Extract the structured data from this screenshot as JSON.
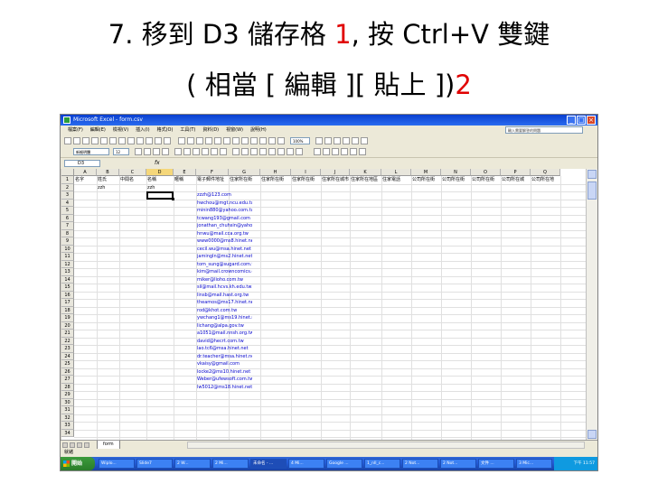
{
  "slide": {
    "line1_prefix": "7. 移到 D3 儲存格 ",
    "line1_num": "1",
    "line1_suffix": ", 按 Ctrl+V 雙鍵",
    "line2_prefix": "( 相當 [ 編輯 ][ 貼上 ])",
    "line2_num": "2"
  },
  "window": {
    "title": "Microsoft Excel - form.csv",
    "menu": [
      "檔案(F)",
      "編輯(E)",
      "檢視(V)",
      "插入(I)",
      "格式(O)",
      "工具(T)",
      "資料(D)",
      "視窗(W)",
      "說明(H)"
    ],
    "help_placeholder": "輸入需要解答的問題",
    "zoom": "100%",
    "font_name": "新細明體",
    "font_size": "12",
    "name_box": "D3",
    "fx": "fx"
  },
  "grid": {
    "columns": [
      "A",
      "B",
      "C",
      "D",
      "E",
      "F",
      "G",
      "H",
      "I",
      "J",
      "K",
      "L",
      "M",
      "N",
      "O",
      "P",
      "Q"
    ],
    "selected_column": "D",
    "row_numbers": [
      "1",
      "2",
      "3",
      "4",
      "5",
      "6",
      "7",
      "8",
      "9",
      "10",
      "11",
      "12",
      "13",
      "14",
      "15",
      "16",
      "17",
      "18",
      "19",
      "20",
      "21",
      "22",
      "23",
      "24",
      "25",
      "26",
      "27",
      "28",
      "29",
      "30",
      "31",
      "32",
      "33",
      "34"
    ],
    "headers": [
      "名字",
      "姓氏",
      "中間名",
      "名稱",
      "暱稱",
      "電子郵件地址",
      "住家所在街",
      "住家所在街",
      "住家所在街",
      "住家所在城市",
      "住家所在地區",
      "住家電話",
      "公司所在街",
      "公司所在街",
      "公司所在街",
      "公司所在城",
      "公司所在地"
    ],
    "row2": {
      "b": "zzh",
      "d": "zzh"
    },
    "emails": [
      "zzzh@123.com",
      "hwchou@mgt.ncu.edu.tw",
      "minin880@yahoo.com.tw",
      "tcwang193@gmail.com",
      "jonathan_chuhsin@yahoo.com",
      "hnwu@mail.cca.org.tw",
      "www0000@ms8.hinet.net",
      "cecil.wu@msa.hinet.net",
      "jamingln@ms2.hinet.net",
      "tom_sung@sugard.com.tw",
      "kim@mail.crowncomics.com.tw",
      "miker@lioho.com.tw",
      "sil@mail.hcvs.kh.edu.tw",
      "linsb@mail.hast.org.tw",
      "theamos@ms17.hinet.net",
      "rod@khot.com.tw",
      "ywchang1@ms19.hinet.net",
      "lichang@alpa.gov.tw",
      "a1051@mail.nnsh.org.tw",
      "david@hecrt.com.tw",
      "lao.tc6@msa.hinet.net",
      "dr.teacher@msa.hinet.net",
      "vkaisy@gmail.com",
      "locke2@ms10.hinet.net",
      "Weber@ufewsoft.com.tw",
      "lw5012@ms18.hinet.net"
    ]
  },
  "sheet_tab": "form",
  "status": "就緒",
  "taskbar": {
    "start": "開始",
    "items": [
      "Wiplo...",
      "Slide7",
      "2 W...",
      "2 Mi...",
      "未命名 - ...",
      "4 Mi...",
      "Google ...",
      "1_nll_c...",
      "2 Not...",
      "2 Not...",
      "文件 ...",
      "3 Mic..."
    ],
    "clock": "下午 11:57"
  }
}
